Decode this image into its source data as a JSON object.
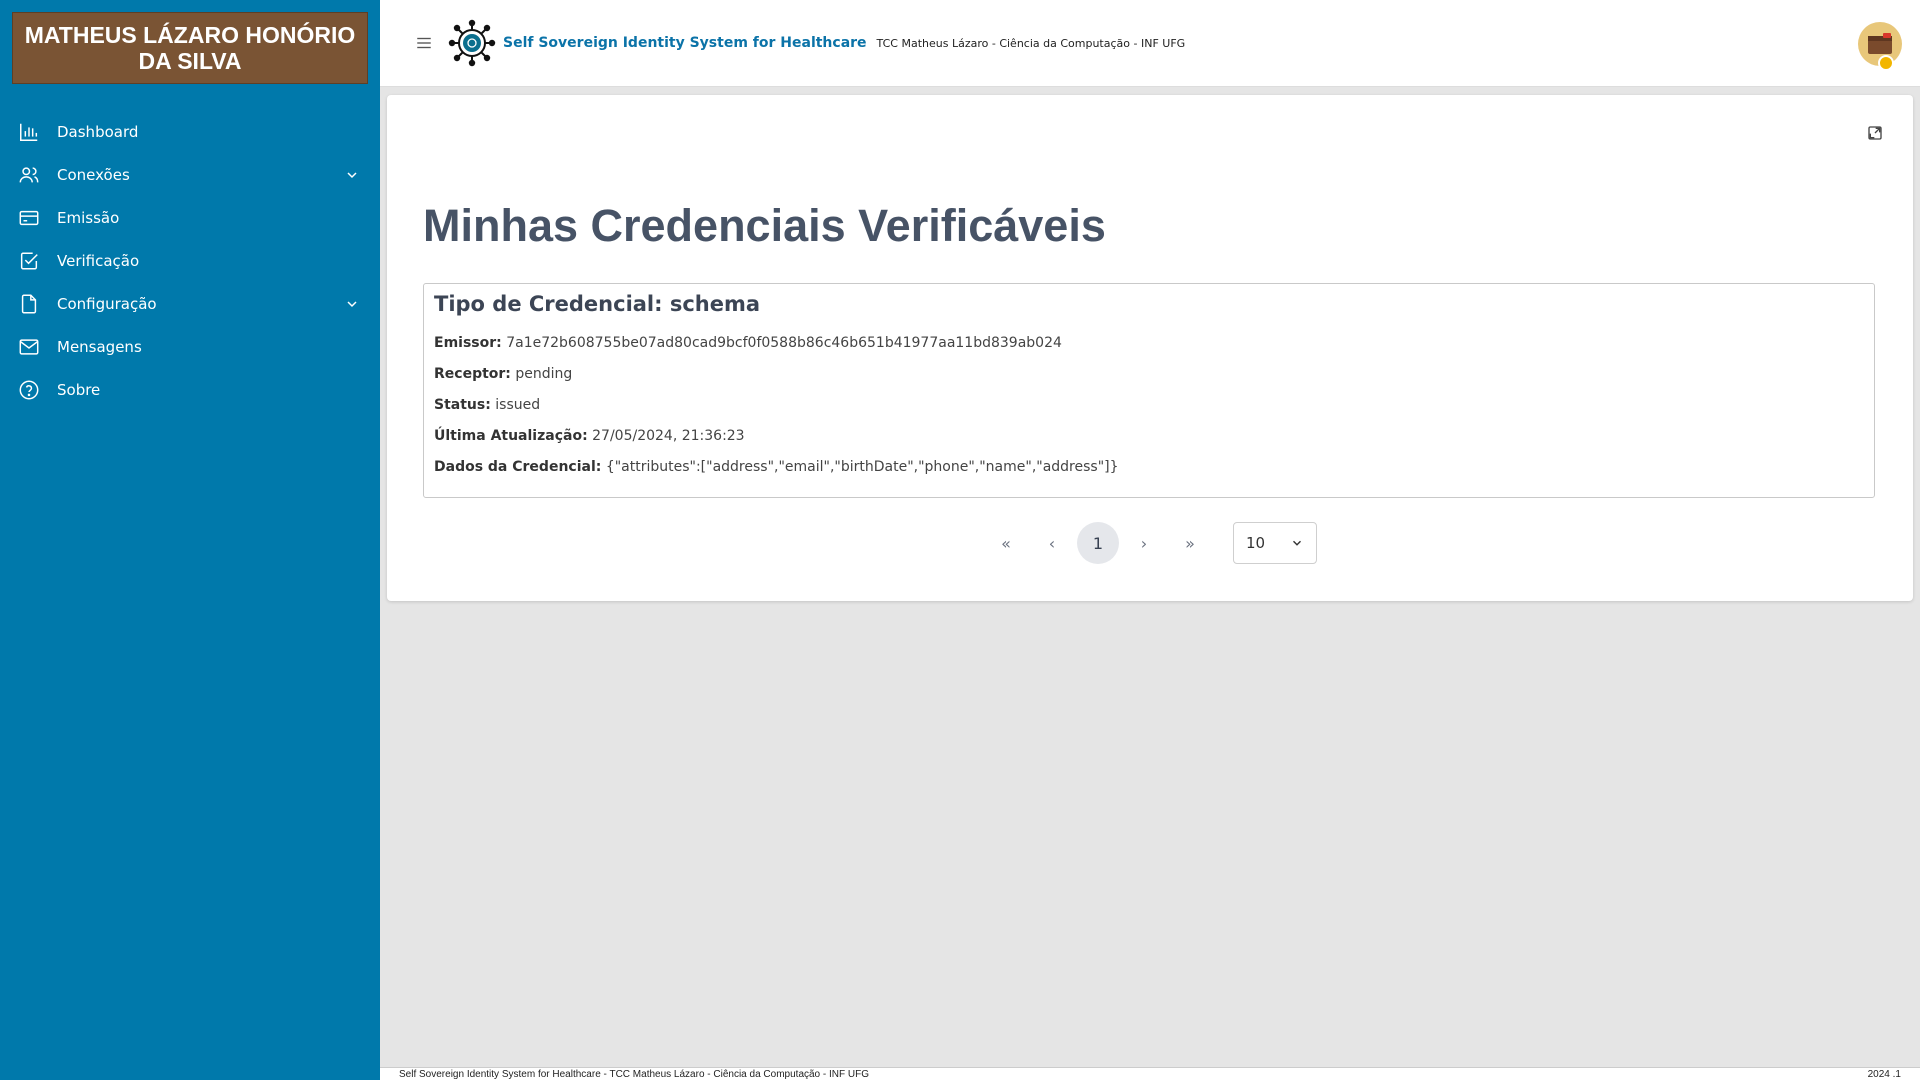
{
  "sidebar": {
    "user_name": "MATHEUS LÁZARO HONÓRIO DA SILVA",
    "items": [
      {
        "label": "Dashboard",
        "icon": "bar-chart-icon"
      },
      {
        "label": "Conexões",
        "icon": "users-icon",
        "expandable": true
      },
      {
        "label": "Emissão",
        "icon": "credit-card-icon"
      },
      {
        "label": "Verificação",
        "icon": "check-square-icon"
      },
      {
        "label": "Configuração",
        "icon": "file-icon",
        "expandable": true
      },
      {
        "label": "Mensagens",
        "icon": "mail-icon"
      },
      {
        "label": "Sobre",
        "icon": "help-circle-icon"
      }
    ]
  },
  "header": {
    "app_name": "Self Sovereign Identity System for Healthcare",
    "subtitle": "TCC Matheus Lázaro - Ciência da Computação - INF UFG"
  },
  "main": {
    "title": "Minhas Credenciais Verificáveis",
    "credential": {
      "type_label": "Tipo de Credencial: schema",
      "fields": [
        {
          "label": "Emissor:",
          "value": "7a1e72b608755be07ad80cad9bcf0f0588b86c46b651b41977aa11bd839ab024"
        },
        {
          "label": "Receptor:",
          "value": "pending"
        },
        {
          "label": "Status:",
          "value": "issued"
        },
        {
          "label": "Última Atualização:",
          "value": "27/05/2024, 21:36:23"
        },
        {
          "label": "Dados da Credencial:",
          "value": "{\"attributes\":[\"address\",\"email\",\"birthDate\",\"phone\",\"name\",\"address\"]}"
        }
      ]
    },
    "pagination": {
      "first": "«",
      "prev": "‹",
      "current_page": "1",
      "next": "›",
      "last": "»",
      "page_size": "10"
    }
  },
  "footer": {
    "left": "Self Sovereign Identity System for Healthcare - TCC Matheus Lázaro - Ciência da Computação - INF UFG",
    "right": "2024 .1"
  },
  "colors": {
    "sidebar": "#0079ab",
    "user_banner": "#7a5434",
    "brand": "#0b73a8",
    "title": "#475366"
  }
}
